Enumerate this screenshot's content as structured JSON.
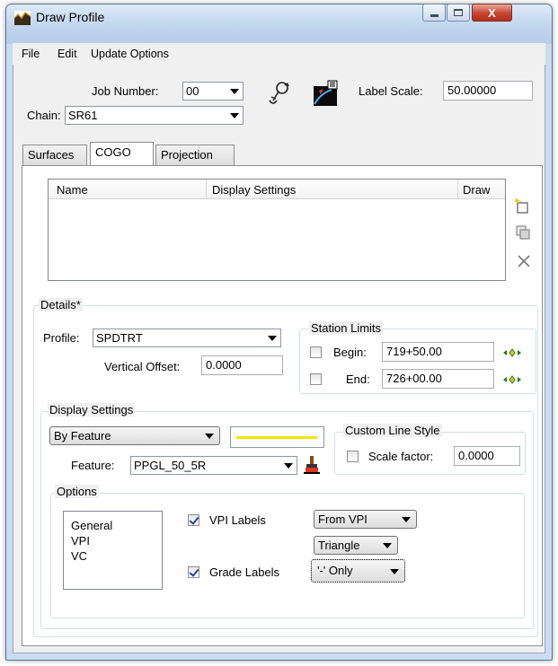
{
  "window": {
    "title": "Draw Profile",
    "close_glyph": "X"
  },
  "menu": {
    "items": [
      "File",
      "Edit",
      "Update Options"
    ]
  },
  "header": {
    "job_number_label": "Job Number:",
    "job_number_value": "00",
    "chain_label": "Chain:",
    "chain_value": "SR61",
    "label_scale_label": "Label Scale:",
    "label_scale_value": "50.00000"
  },
  "tabs": [
    "Surfaces",
    "COGO",
    "Projection"
  ],
  "active_tab": "COGO",
  "table": {
    "columns": [
      "Name",
      "Display Settings",
      "Draw"
    ],
    "rows": []
  },
  "details": {
    "title": "Details*",
    "profile_label": "Profile:",
    "profile_value": "SPDTRT",
    "vertical_offset_label": "Vertical Offset:",
    "vertical_offset_value": "0.0000",
    "station_limits": {
      "title": "Station Limits",
      "begin_label": "Begin:",
      "begin_value": "719+50.00",
      "begin_checked": false,
      "end_label": "End:",
      "end_value": "726+00.00",
      "end_checked": false
    }
  },
  "display_settings": {
    "title": "Display Settings",
    "mode_value": "By Feature",
    "line_color": "#f2e600",
    "feature_label": "Feature:",
    "feature_value": "PPGL_50_5R",
    "custom_line_style": {
      "title": "Custom Line Style",
      "scale_factor_label": "Scale factor:",
      "scale_factor_value": "0.0000",
      "scale_factor_checked": false
    }
  },
  "options": {
    "title": "Options",
    "list_items": [
      "General",
      "VPI",
      "VC"
    ],
    "vpi_labels": {
      "label": "VPI Labels",
      "checked": true,
      "from_value": "From VPI",
      "shape_value": "Triangle"
    },
    "grade_labels": {
      "label": "Grade Labels",
      "checked": true,
      "only_value": "'-' Only"
    }
  },
  "icons": {
    "app": "profile-app-icon",
    "tool1": "anchor-select-icon",
    "tool2": "draw-profile-icon",
    "add": "add-item-icon",
    "copy": "copy-item-icon",
    "delete": "delete-x-icon",
    "pick": "target-pick-icon",
    "brush": "style-brush-icon"
  }
}
